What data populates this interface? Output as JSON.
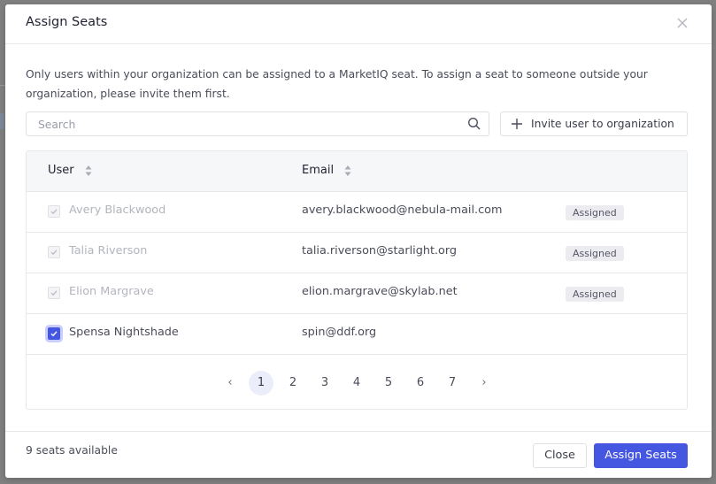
{
  "modal": {
    "title": "Assign Seats",
    "close_icon": "close-x-icon",
    "description": "Only users within your organization can be assigned to a MarketIQ seat. To assign a seat to someone outside your organization, please invite them first."
  },
  "toolbar": {
    "search_placeholder": "Search",
    "search_value": "",
    "search_icon": "magnifier-icon",
    "invite_icon": "plus-icon",
    "invite_label": "Invite user to organization"
  },
  "table": {
    "columns": [
      {
        "label": "User",
        "sortable": true
      },
      {
        "label": "Email",
        "sortable": true
      },
      {
        "label": ""
      }
    ],
    "rows": [
      {
        "name": "Avery Blackwood",
        "email": "avery.blackwood@nebula-mail.com",
        "status": "Assigned",
        "checked": true,
        "disabled": true
      },
      {
        "name": "Talia Riverson",
        "email": "talia.riverson@starlight.org",
        "status": "Assigned",
        "checked": true,
        "disabled": true
      },
      {
        "name": "Elion Margrave",
        "email": "elion.margrave@skylab.net",
        "status": "Assigned",
        "checked": true,
        "disabled": true
      },
      {
        "name": "Spensa Nightshade",
        "email": "spin@ddf.org",
        "status": "",
        "checked": true,
        "disabled": false
      }
    ]
  },
  "pagination": {
    "prev": "‹",
    "next": "›",
    "pages": [
      "1",
      "2",
      "3",
      "4",
      "5",
      "6",
      "7"
    ],
    "current": "1"
  },
  "footer": {
    "seats_available": "9 seats available",
    "close_label": "Close",
    "assign_label": "Assign Seats"
  },
  "colors": {
    "accent": "#4556e0",
    "badge_bg": "#ebebf0",
    "current_page_bg": "#ebedfb"
  }
}
